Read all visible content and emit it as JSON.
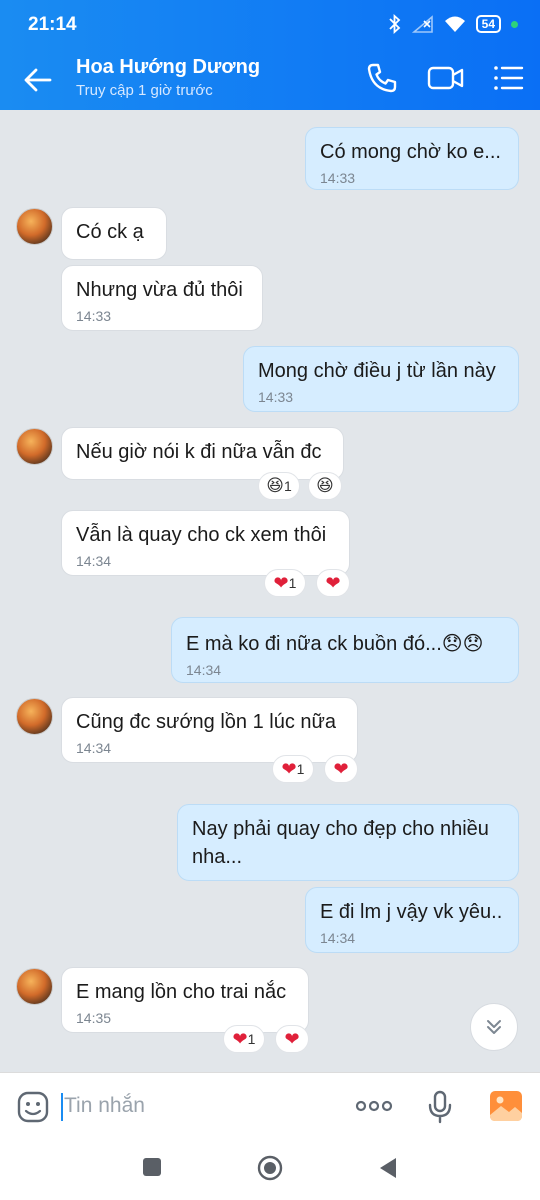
{
  "status_bar": {
    "time": "21:14",
    "battery": "54"
  },
  "header": {
    "contact_name": "Hoa Hướng Dương",
    "last_seen": "Truy cập 1 giờ trước"
  },
  "messages": [
    {
      "dir": "out",
      "text": "Có mong chờ ko e...",
      "time": "14:33"
    },
    {
      "dir": "in",
      "text": "Có ck ạ",
      "time": ""
    },
    {
      "dir": "in",
      "text": "Nhưng vừa đủ thôi",
      "time": "14:33"
    },
    {
      "dir": "out",
      "text": "Mong chờ điều j từ lần này",
      "time": "14:33"
    },
    {
      "dir": "in",
      "text": "Nếu giờ nói k đi nữa vẫn đc",
      "time": "",
      "reaction_count": "1"
    },
    {
      "dir": "in",
      "text": "Vẫn là quay cho ck xem thôi",
      "time": "14:34",
      "reaction_count": "1"
    },
    {
      "dir": "out",
      "text": "E mà ko đi nữa ck buồn đó...😞😞",
      "time": "14:34"
    },
    {
      "dir": "in",
      "text": "Cũng đc sướng lồn 1 lúc nữa",
      "time": "14:34",
      "reaction_count": "1"
    },
    {
      "dir": "out",
      "text_line1": "Nay phải quay cho đẹp cho nhiều",
      "text_line2": "nha...",
      "time": ""
    },
    {
      "dir": "out",
      "text": "E đi lm j vậy vk yêu..",
      "time": "14:34"
    },
    {
      "dir": "in",
      "text": "E mang lồn cho trai nắc",
      "time": "14:35",
      "reaction_count": "1"
    }
  ],
  "input": {
    "placeholder": "Tin nhắn"
  },
  "colors": {
    "header": "#1a8cf2",
    "outgoing_bubble": "#d6edff",
    "incoming_bubble": "#ffffff",
    "heart": "#e0203a",
    "background": "#e2e6ea"
  },
  "icons": [
    "back-arrow-icon",
    "phone-icon",
    "video-call-icon",
    "menu-list-icon",
    "sticker-icon",
    "more-icon",
    "microphone-icon",
    "image-icon",
    "scroll-down-icon",
    "heart-icon",
    "laugh-emoji-icon"
  ]
}
